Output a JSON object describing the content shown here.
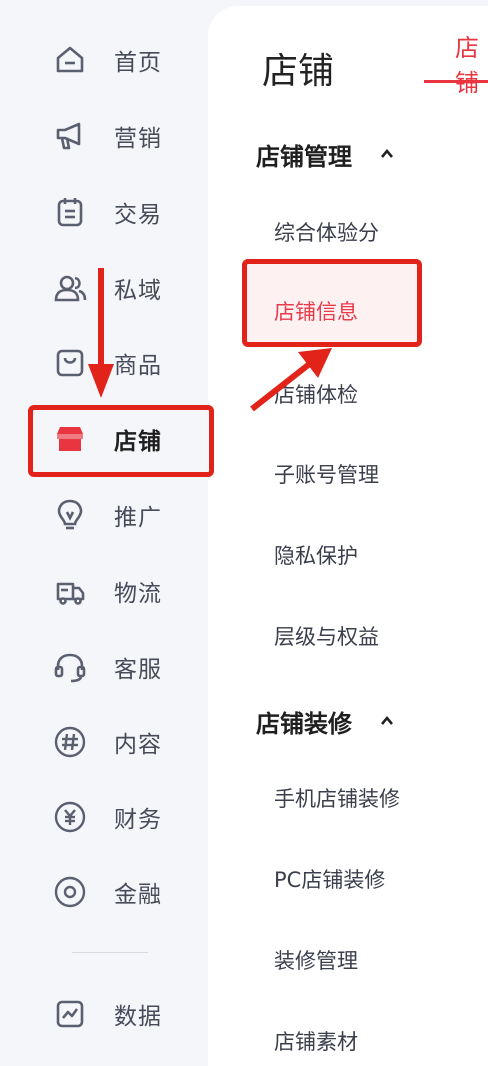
{
  "colors": {
    "accent": "#e8353f",
    "annotation": "#e2231a"
  },
  "nav": {
    "items": [
      {
        "label": "首页",
        "icon": "home-icon"
      },
      {
        "label": "营销",
        "icon": "megaphone-icon"
      },
      {
        "label": "交易",
        "icon": "clipboard-icon"
      },
      {
        "label": "私域",
        "icon": "users-icon"
      },
      {
        "label": "商品",
        "icon": "bag-icon"
      },
      {
        "label": "店铺",
        "icon": "store-icon",
        "active": true
      },
      {
        "label": "推广",
        "icon": "bulb-icon"
      },
      {
        "label": "物流",
        "icon": "truck-icon"
      },
      {
        "label": "客服",
        "icon": "headset-icon"
      },
      {
        "label": "内容",
        "icon": "hash-icon"
      },
      {
        "label": "财务",
        "icon": "yuan-icon"
      },
      {
        "label": "金融",
        "icon": "coin-icon"
      },
      {
        "label": "数据",
        "icon": "chart-icon"
      }
    ]
  },
  "panel": {
    "title": "店铺",
    "tab_label": "店铺",
    "sections": [
      {
        "title": "店铺管理",
        "items": [
          "综合体验分",
          "店铺信息",
          "店铺体检",
          "子账号管理",
          "隐私保护",
          "层级与权益"
        ]
      },
      {
        "title": "店铺装修",
        "items": [
          "手机店铺装修",
          "PC店铺装修",
          "装修管理",
          "店铺素材"
        ]
      }
    ]
  }
}
